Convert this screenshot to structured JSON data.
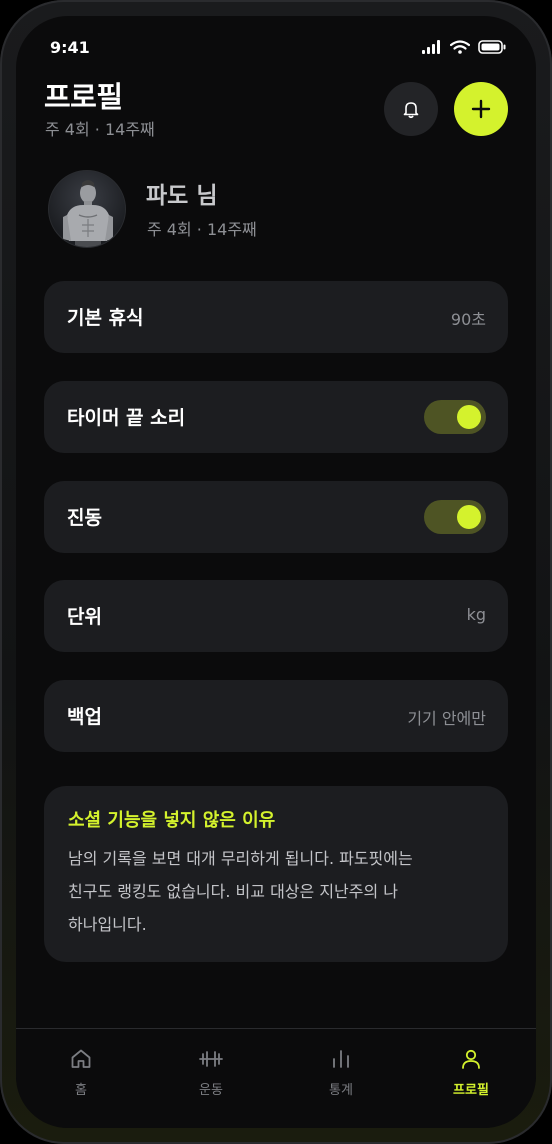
{
  "status_bar": {
    "time": "9:41"
  },
  "header": {
    "title": "프로필",
    "subtitle": "주 4회 · 14주째",
    "bell_icon": "bell-icon",
    "add_icon": "plus-icon"
  },
  "profile": {
    "name": "파도 님",
    "meta": "주 4회 · 14주째"
  },
  "settings": [
    {
      "label": "기본 휴식",
      "value": "90초",
      "type": "value"
    },
    {
      "label": "타이머 끝 소리",
      "type": "toggle",
      "on": true
    },
    {
      "label": "진동",
      "type": "toggle",
      "on": true
    },
    {
      "label": "단위",
      "value": "kg",
      "type": "value"
    },
    {
      "label": "백업",
      "value": "기기 안에만",
      "type": "value"
    }
  ],
  "info": {
    "title": "소셜 기능을 넣지 않은 이유",
    "line1": "남의 기록을 보면 대개 무리하게 됩니다. 파도핏에는",
    "line2": "친구도 랭킹도 없습니다. 비교 대상은 지난주의 나",
    "line3": "하나입니다."
  },
  "nav": [
    {
      "label": "홈",
      "icon": "home-icon",
      "active": false
    },
    {
      "label": "운동",
      "icon": "dumbbell-icon",
      "active": false
    },
    {
      "label": "통계",
      "icon": "bar-chart-icon",
      "active": false
    },
    {
      "label": "프로필",
      "icon": "person-icon",
      "active": true
    }
  ],
  "colors": {
    "accent": "#d4f22d",
    "background": "#0b0b0c",
    "card": "#1c1d20",
    "muted": "#8d8f94"
  }
}
